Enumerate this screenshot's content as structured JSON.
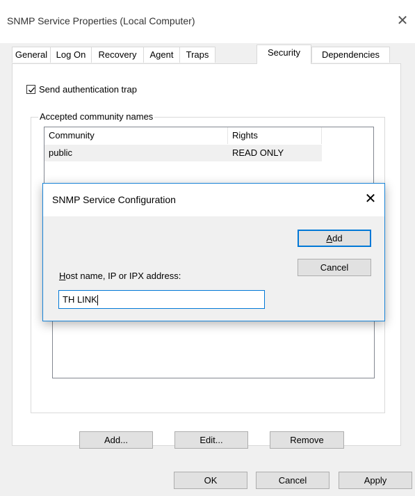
{
  "window": {
    "title": "SNMP Service Properties (Local Computer)",
    "close_glyph": "✕"
  },
  "tabs": [
    {
      "label": "General"
    },
    {
      "label": "Log On"
    },
    {
      "label": "Recovery"
    },
    {
      "label": "Agent"
    },
    {
      "label": "Traps"
    },
    {
      "label": "Security",
      "active": true
    },
    {
      "label": "Dependencies"
    }
  ],
  "security": {
    "send_auth_trap_label": "Send authentication trap",
    "send_auth_trap_checked": true,
    "community_group_label": "Accepted community names",
    "community_columns": [
      "Community",
      "Rights"
    ],
    "community_rows": [
      {
        "community": "public",
        "rights": "READ ONLY"
      }
    ],
    "hosts_buttons": {
      "add": "Add...",
      "edit": "Edit...",
      "remove": "Remove"
    }
  },
  "footer": {
    "ok": "OK",
    "cancel": "Cancel",
    "apply": "Apply"
  },
  "dialog": {
    "title": "SNMP Service Configuration",
    "close_glyph": "✕",
    "host_label_accel": "H",
    "host_label_rest": "ost name, IP or IPX address:",
    "host_value": "TH LINK",
    "add_accel": "A",
    "add_rest": "dd",
    "cancel": "Cancel"
  },
  "colors": {
    "accent": "#0078d7",
    "window_bg": "#f0f0f0",
    "panel_bg": "#ffffff"
  }
}
